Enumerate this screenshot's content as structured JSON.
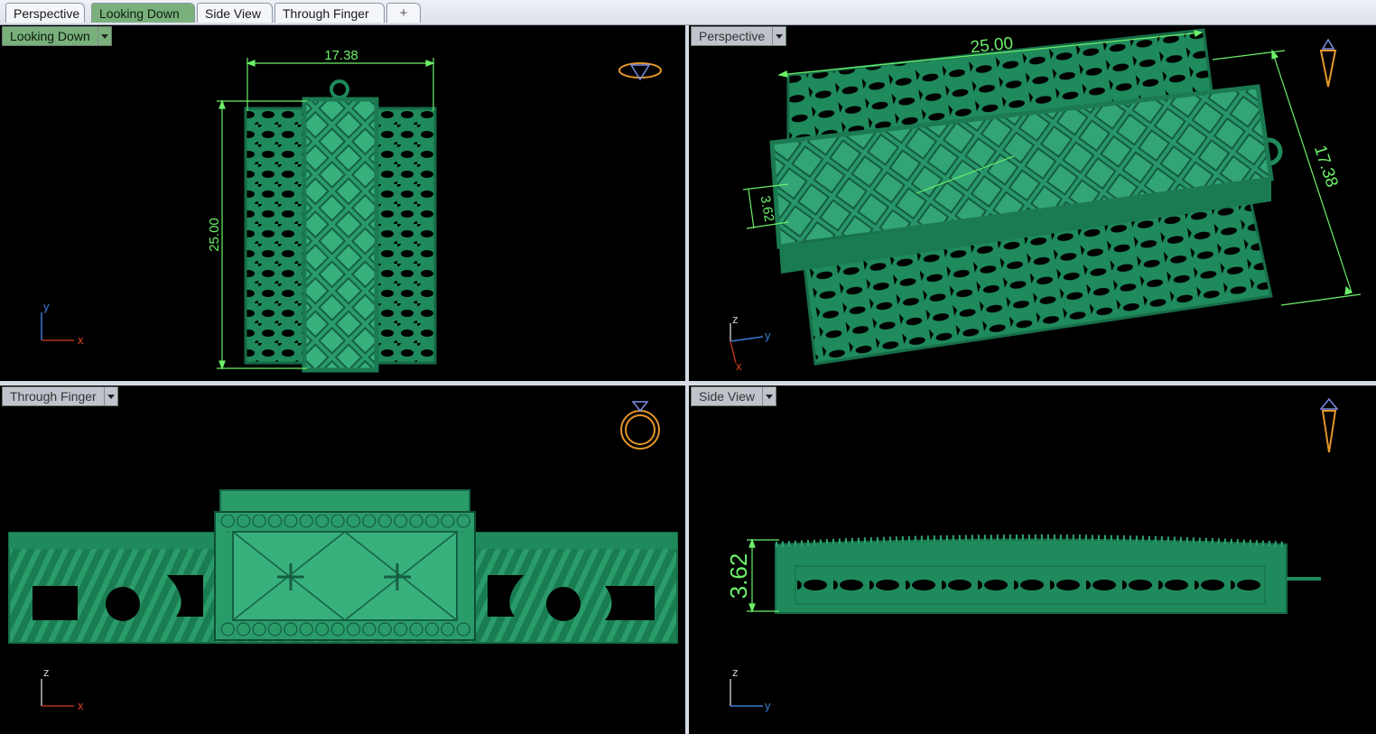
{
  "tabs": [
    {
      "label": "Perspective",
      "active": false
    },
    {
      "label": "Looking Down",
      "active": true
    },
    {
      "label": "Side View",
      "active": false
    },
    {
      "label": "Through Finger",
      "active": false
    }
  ],
  "add_tab_symbol": "+",
  "viewports": {
    "top_left": {
      "label": "Looking Down",
      "active": true,
      "dim_width": "17.38",
      "dim_height": "25.00",
      "axis_v": "y",
      "axis_h": "x",
      "icon": "ring-top-view-icon"
    },
    "top_right": {
      "label": "Perspective",
      "active": false,
      "dim_length": "25.00",
      "dim_width": "17.38",
      "dim_height": "3.62",
      "axis_z": "z",
      "axis_y": "y",
      "axis_x": "x",
      "icon": "ring-perspective-icon"
    },
    "bottom_left": {
      "label": "Through Finger",
      "active": false,
      "axis_v": "z",
      "axis_h": "x",
      "icon": "ring-front-icon"
    },
    "bottom_right": {
      "label": "Side View",
      "active": false,
      "dim_height": "3.62",
      "axis_v": "z",
      "axis_h": "y",
      "icon": "ring-side-icon"
    }
  },
  "colors": {
    "model": "#1f8a5c",
    "dimension": "#6cf06a",
    "active_tab": "#79b07c",
    "background": "#000000",
    "icon": "#e3962a"
  }
}
